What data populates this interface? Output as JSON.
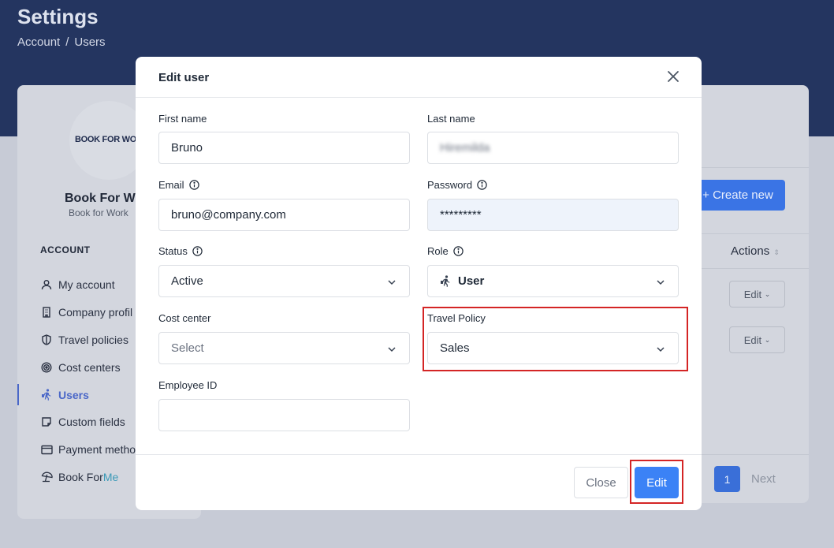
{
  "header": {
    "title": "Settings",
    "breadcrumb": [
      "Account",
      "Users"
    ],
    "breadcrumb_separator": "/"
  },
  "sidebar": {
    "logo_text": "BOOK FOR WO",
    "company_name": "Book For Wo",
    "company_sub": "Book for Work",
    "section_heading": "ACCOUNT",
    "items": [
      {
        "label": "My account",
        "icon": "user-icon"
      },
      {
        "label": "Company profil",
        "icon": "building-icon"
      },
      {
        "label": "Travel policies",
        "icon": "shield-icon"
      },
      {
        "label": "Cost centers",
        "icon": "target-icon"
      },
      {
        "label": "Users",
        "icon": "traveler-icon",
        "active": true
      },
      {
        "label": "Custom fields",
        "icon": "note-icon"
      },
      {
        "label": "Payment metho",
        "icon": "credit-card-icon"
      },
      {
        "label_prefix": "Book For ",
        "label_suffix": "Me",
        "icon": "beach-umbrella-icon"
      }
    ]
  },
  "main": {
    "create_button": "+ Create new",
    "actions_header": "Actions",
    "row_edit_label": "Edit",
    "pagination": {
      "current_page": "1",
      "next_label": "Next"
    }
  },
  "modal": {
    "title": "Edit user",
    "fields": {
      "first_name": {
        "label": "First name",
        "value": "Bruno"
      },
      "last_name": {
        "label": "Last name",
        "value": "Hiremilda"
      },
      "email": {
        "label": "Email",
        "value": "bruno@company.com"
      },
      "password": {
        "label": "Password",
        "value": "*********"
      },
      "status": {
        "label": "Status",
        "value": "Active"
      },
      "role": {
        "label": "Role",
        "value": "User"
      },
      "cost_center": {
        "label": "Cost center",
        "placeholder": "Select"
      },
      "travel_policy": {
        "label": "Travel Policy",
        "value": "Sales"
      },
      "employee_id": {
        "label": "Employee ID",
        "value": ""
      }
    },
    "close_button": "Close",
    "edit_button": "Edit"
  },
  "colors": {
    "header_bg": "#243560",
    "primary": "#3b82f6",
    "highlight": "#d42525",
    "active_nav": "#4a67c8"
  }
}
